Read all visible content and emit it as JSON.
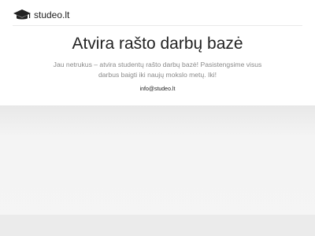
{
  "brand": {
    "name": "studeo.lt",
    "icon": "graduation-cap-icon"
  },
  "hero": {
    "title": "Atvira rašto darbų bazė",
    "text": "Jau netrukus – atvira studentų rašto darbų bazė! Pasistengsime visus darbus baigti iki naujų mokslo metų. Iki!",
    "email": "info@studeo.lt"
  },
  "colors": {
    "text": "#222222",
    "muted": "#8a8a8a",
    "band": "#f4f4f4"
  }
}
